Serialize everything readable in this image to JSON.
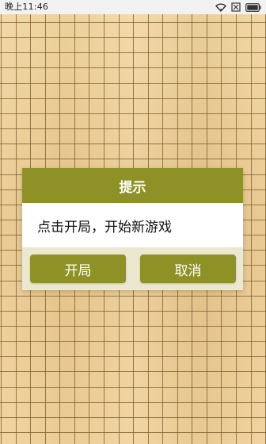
{
  "status_bar": {
    "time": "晚上11:46",
    "icons": [
      "wifi-icon",
      "sim-off-icon",
      "battery-icon"
    ]
  },
  "board": {
    "grid_lines_vertical": 19,
    "grid_lines_horizontal": 29,
    "line_color": "#7a5a2a",
    "wood_color": "#e9c98f"
  },
  "dialog": {
    "title": "提示",
    "message": "点击开局，开始新游戏",
    "buttons": {
      "start": "开局",
      "cancel": "取消"
    },
    "accent_color": "#8e9226",
    "footer_color": "#ece7cf"
  }
}
